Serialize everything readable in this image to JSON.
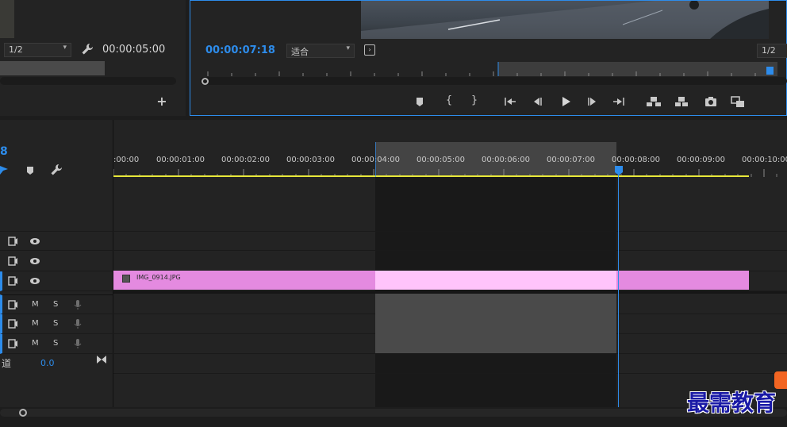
{
  "source_monitor": {
    "resolution": "1/2",
    "timecode": "00:00:05:00"
  },
  "program_monitor": {
    "timecode": "00:00:07:18",
    "fit_label": "适合",
    "resolution": "1/2"
  },
  "timeline": {
    "current_tc_fragment": "8",
    "ruler_labels": [
      ":00:00",
      "00:00:01:00",
      "00:00:02:00",
      "00:00:03:00",
      "00:00:04:00",
      "00:00:05:00",
      "00:00:06:00",
      "00:00:07:00",
      "00:00:08:00",
      "00:00:09:00",
      "00:00:10:00"
    ],
    "clip_name": "IMG_0914.JPG",
    "audio_tracks": [
      {
        "mute": "M",
        "solo": "S"
      },
      {
        "mute": "M",
        "solo": "S"
      },
      {
        "mute": "M",
        "solo": "S"
      }
    ],
    "master_label": "道",
    "master_value": "0.0"
  },
  "watermark": "最需教育",
  "colors": {
    "accent_blue": "#2d8ceb",
    "clip_pink": "#e48ae0",
    "clip_pink_light": "#ffc4fb",
    "workarea_yellow": "#e8e83a"
  }
}
